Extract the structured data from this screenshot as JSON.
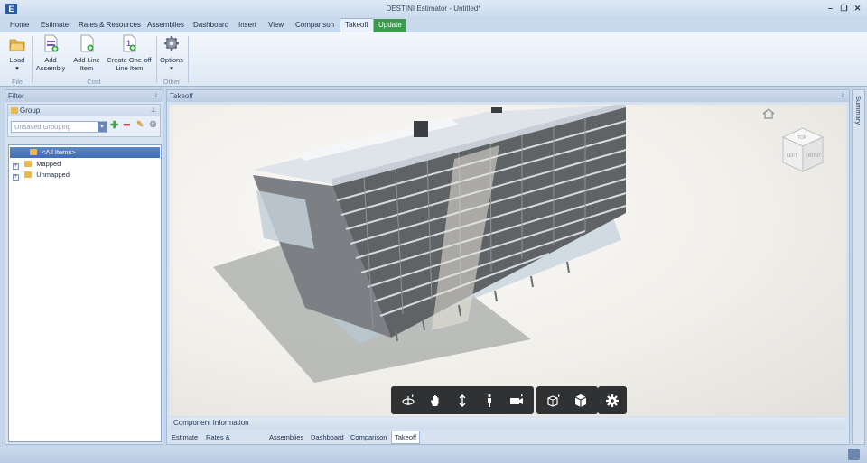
{
  "window": {
    "title": "DESTINI Estimator - Untitled*",
    "logo": "E"
  },
  "menu": [
    {
      "label": "Home"
    },
    {
      "label": "Estimate"
    },
    {
      "label": "Rates & Resources"
    },
    {
      "label": "Assemblies"
    },
    {
      "label": "Dashboard"
    },
    {
      "label": "Insert"
    },
    {
      "label": "View"
    },
    {
      "label": "Comparison"
    },
    {
      "label": "Takeoff"
    },
    {
      "label": "Update"
    }
  ],
  "ribbon": {
    "load": "Load",
    "add_assembly_1": "Add",
    "add_assembly_2": "Assembly",
    "add_line_1": "Add Line",
    "add_line_2": "Item",
    "one_off_1": "Create One-off",
    "one_off_2": "Line Item",
    "options": "Options",
    "group_file": "File",
    "group_cost": "Cost",
    "group_other": "Other"
  },
  "filter": {
    "title": "Filter",
    "group_title": "Group",
    "grouping_placeholder": "Unsaved Grouping",
    "tree": [
      {
        "label": "<All Items>"
      },
      {
        "label": "Mapped"
      },
      {
        "label": "Unmapped"
      }
    ]
  },
  "takeoff": {
    "title": "Takeoff",
    "component_info": "Component Information",
    "nav_cube": {
      "top": "TOP",
      "left": "LEFT",
      "front": "FRONT"
    }
  },
  "bottom_tabs": [
    {
      "label": "Estimate"
    },
    {
      "label": "Rates & Resources"
    },
    {
      "label": "Assemblies"
    },
    {
      "label": "Dashboard"
    },
    {
      "label": "Comparison"
    },
    {
      "label": "Takeoff"
    }
  ],
  "side_panel": {
    "label": "Summary"
  },
  "viewer_tools": {
    "group1": [
      "orbit-icon",
      "pan-icon",
      "zoom-icon",
      "walk-icon",
      "camera-icon"
    ],
    "group2": [
      "explode-icon",
      "model-view-icon"
    ],
    "group3": [
      "settings-icon"
    ]
  },
  "colors": {
    "update_tab": "#3a9b4c",
    "selection": "#4a78bd",
    "viewer_toolbar": "#2f3133"
  }
}
